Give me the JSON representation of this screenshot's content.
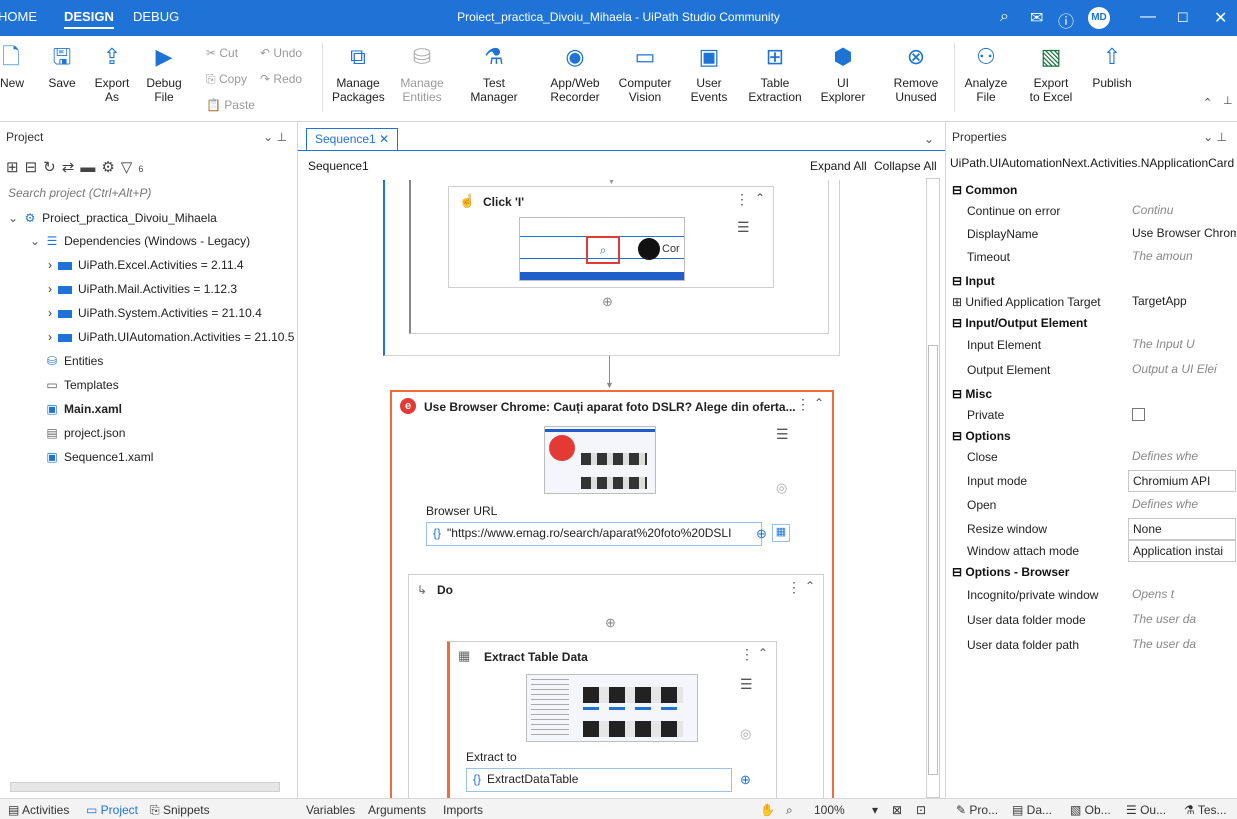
{
  "titlebar": {
    "tabs": [
      "HOME",
      "DESIGN",
      "DEBUG"
    ],
    "active_tab": "DESIGN",
    "window_title": "Proiect_practica_Divoiu_Mihaela - UiPath Studio Community",
    "user_initials": "MD"
  },
  "ribbon": {
    "new": "New",
    "save": "Save",
    "export_as": "Export\nAs",
    "debug_file": "Debug\nFile",
    "cut": "Cut",
    "undo": "Undo",
    "copy": "Copy",
    "redo": "Redo",
    "paste": "Paste",
    "manage_packages": "Manage\nPackages",
    "manage_entities": "Manage\nEntities",
    "test_manager": "Test\nManager",
    "app_web_recorder": "App/Web\nRecorder",
    "computer_vision": "Computer\nVision",
    "user_events": "User\nEvents",
    "table_extraction": "Table\nExtraction",
    "ui_explorer": "UI\nExplorer",
    "remove_unused": "Remove\nUnused",
    "analyze_file": "Analyze\nFile",
    "export_to_excel": "Export\nto Excel",
    "publish": "Publish"
  },
  "project_panel": {
    "title": "Project",
    "search_placeholder": "Search project (Ctrl+Alt+P)",
    "filter_count": "6",
    "root": "Proiect_practica_Divoiu_Mihaela",
    "dependencies": "Dependencies (Windows - Legacy)",
    "packages": [
      "UiPath.Excel.Activities = 2.11.4",
      "UiPath.Mail.Activities = 1.12.3",
      "UiPath.System.Activities = 21.10.4",
      "UiPath.UIAutomation.Activities = 21.10.5"
    ],
    "entities": "Entities",
    "templates": "Templates",
    "files": [
      "Main.xaml",
      "project.json",
      "Sequence1.xaml"
    ]
  },
  "designer": {
    "doc_tab": "Sequence1",
    "breadcrumb": "Sequence1",
    "expand_all": "Expand All",
    "collapse_all": "Collapse All",
    "click_activity": "Click 'I'",
    "click_thumb_text": "Cor",
    "use_browser_title": "Use Browser Chrome: Cauți aparat foto DSLR? Alege din oferta...",
    "browser_url_label": "Browser URL",
    "browser_url_value": "\"https://www.emag.ro/search/aparat%20foto%20DSLI",
    "do_label": "Do",
    "extract_title": "Extract Table Data",
    "extract_to_label": "Extract to",
    "extract_to_value": "ExtractDataTable"
  },
  "properties": {
    "title": "Properties",
    "class_name": "UiPath.UIAutomationNext.Activities.NApplicationCard",
    "sections": {
      "common": "Common",
      "input": "Input",
      "io_element": "Input/Output Element",
      "misc": "Misc",
      "options": "Options",
      "options_browser": "Options - Browser"
    },
    "rows": {
      "continue_on_error": {
        "name": "Continue on error",
        "value": "Continu"
      },
      "display_name": {
        "name": "DisplayName",
        "value": "Use Browser Chrome"
      },
      "timeout": {
        "name": "Timeout",
        "value": "The amoun"
      },
      "unified_target": {
        "name": "Unified Application Target",
        "value": "TargetApp"
      },
      "input_element": {
        "name": "Input Element",
        "value": "The Input U"
      },
      "output_element": {
        "name": "Output Element",
        "value": "Output a UI Elei"
      },
      "private": {
        "name": "Private",
        "value": ""
      },
      "close": {
        "name": "Close",
        "value": "Defines whe"
      },
      "input_mode": {
        "name": "Input mode",
        "value": "Chromium API"
      },
      "open": {
        "name": "Open",
        "value": "Defines whe"
      },
      "resize_window": {
        "name": "Resize window",
        "value": "None"
      },
      "window_attach": {
        "name": "Window attach mode",
        "value": "Application instai"
      },
      "incognito": {
        "name": "Incognito/private window",
        "value": "Opens t"
      },
      "user_data_mode": {
        "name": "User data folder mode",
        "value": "The user da"
      },
      "user_data_path": {
        "name": "User data folder path",
        "value": "The user da"
      }
    }
  },
  "bottombar": {
    "left_tabs": [
      "Activities",
      "Project",
      "Snippets"
    ],
    "center_tabs": [
      "Variables",
      "Arguments",
      "Imports"
    ],
    "zoom": "100%",
    "right_tabs": [
      "Pro...",
      "Da...",
      "Ob...",
      "Ou...",
      "Tes..."
    ]
  },
  "colors": {
    "accent": "#1f73d6",
    "browser_card_border": "#f26b3a"
  }
}
